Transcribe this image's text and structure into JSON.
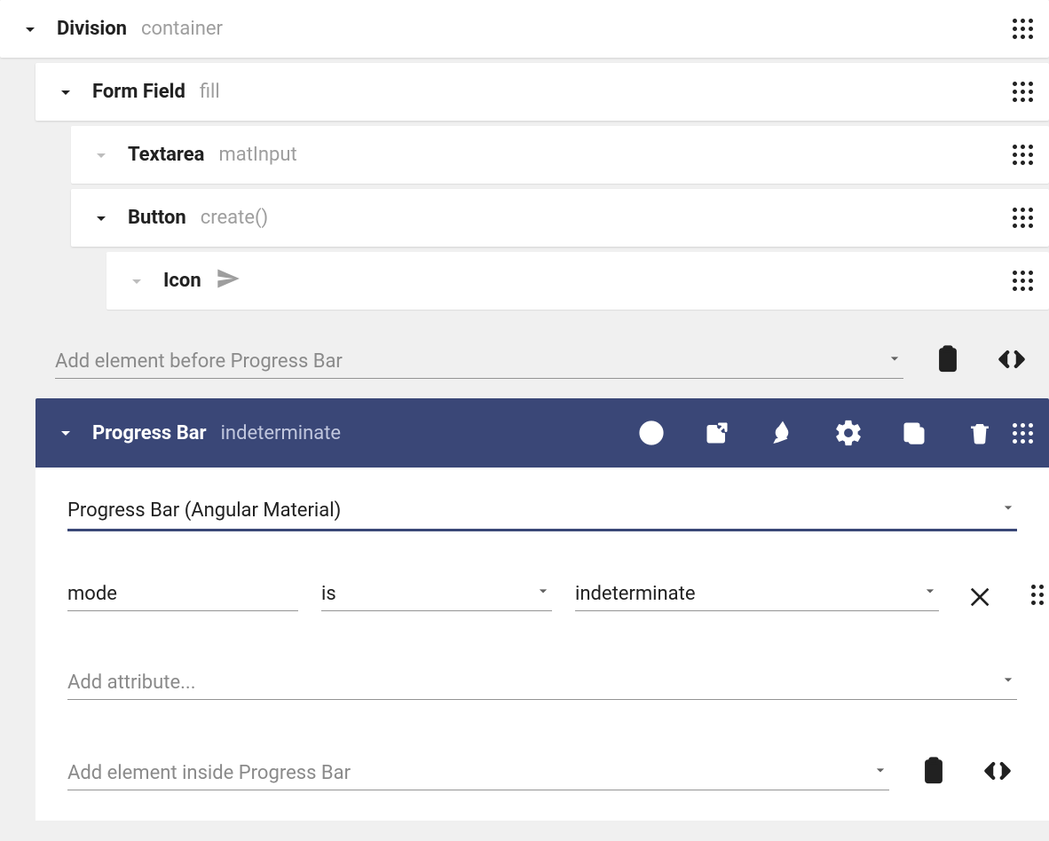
{
  "tree": {
    "division": {
      "title": "Division",
      "sub": "container"
    },
    "form_field": {
      "title": "Form Field",
      "sub": "fill"
    },
    "textarea": {
      "title": "Textarea",
      "sub": "matInput"
    },
    "button": {
      "title": "Button",
      "sub": "create()"
    },
    "icon": {
      "title": "Icon"
    }
  },
  "add_before": {
    "placeholder": "Add element before Progress Bar"
  },
  "selected": {
    "title": "Progress Bar",
    "sub": "indeterminate"
  },
  "selector": {
    "text": "Progress Bar (Angular Material)"
  },
  "attribute": {
    "name": "mode",
    "operator": "is",
    "value": "indeterminate"
  },
  "add_attribute": {
    "placeholder": "Add attribute..."
  },
  "add_inside": {
    "placeholder": "Add element inside Progress Bar"
  }
}
